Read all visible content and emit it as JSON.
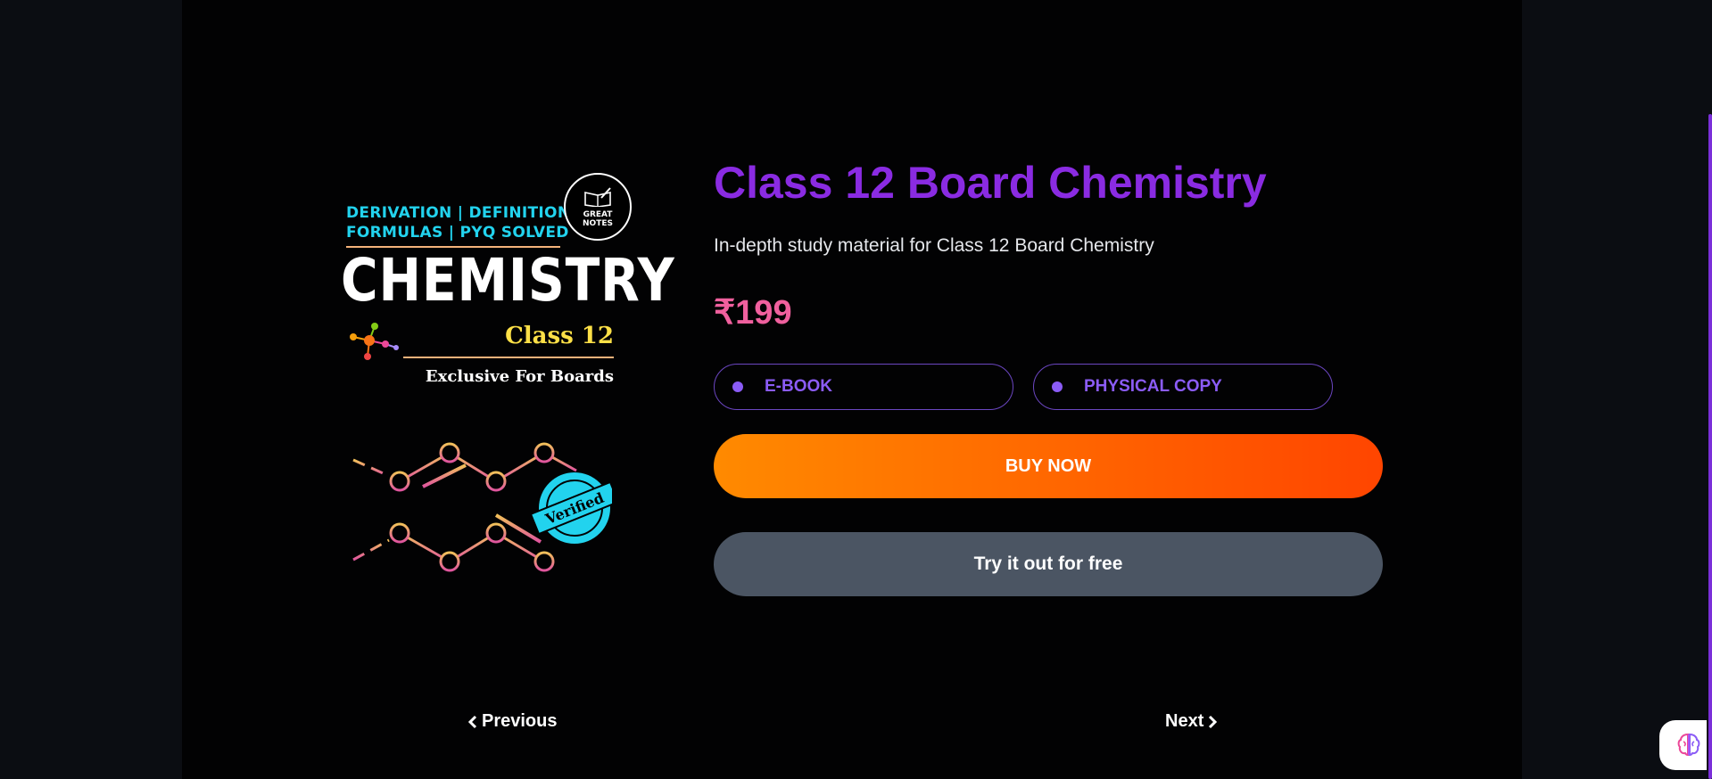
{
  "product": {
    "title": "Class 12 Board Chemistry",
    "description": "In-depth study material for Class 12 Board Chemistry",
    "price": "₹199",
    "options": [
      "E-BOOK",
      "PHYSICAL COPY"
    ],
    "buy_label": "BUY NOW",
    "try_label": "Try it out for free"
  },
  "cover": {
    "line1": "DERIVATION | DEFINITION",
    "line2": "FORMULAS | PYQ SOLVED",
    "brand_line1": "GREAT",
    "brand_line2": "NOTES",
    "title": "CHEMISTRY",
    "class_label": "Class 12",
    "tagline": "Exclusive For Boards",
    "badge": "Verified"
  },
  "nav": {
    "previous": "Previous",
    "next": "Next"
  },
  "colors": {
    "accent": "#8a2be2",
    "price": "#f0609e",
    "buy_start": "#ff8a00",
    "buy_end": "#ff4500",
    "try_bg": "#4b5563"
  },
  "icons": {
    "prev": "chevron-left-icon",
    "next": "chevron-right-icon",
    "assistant": "brain-icon"
  }
}
